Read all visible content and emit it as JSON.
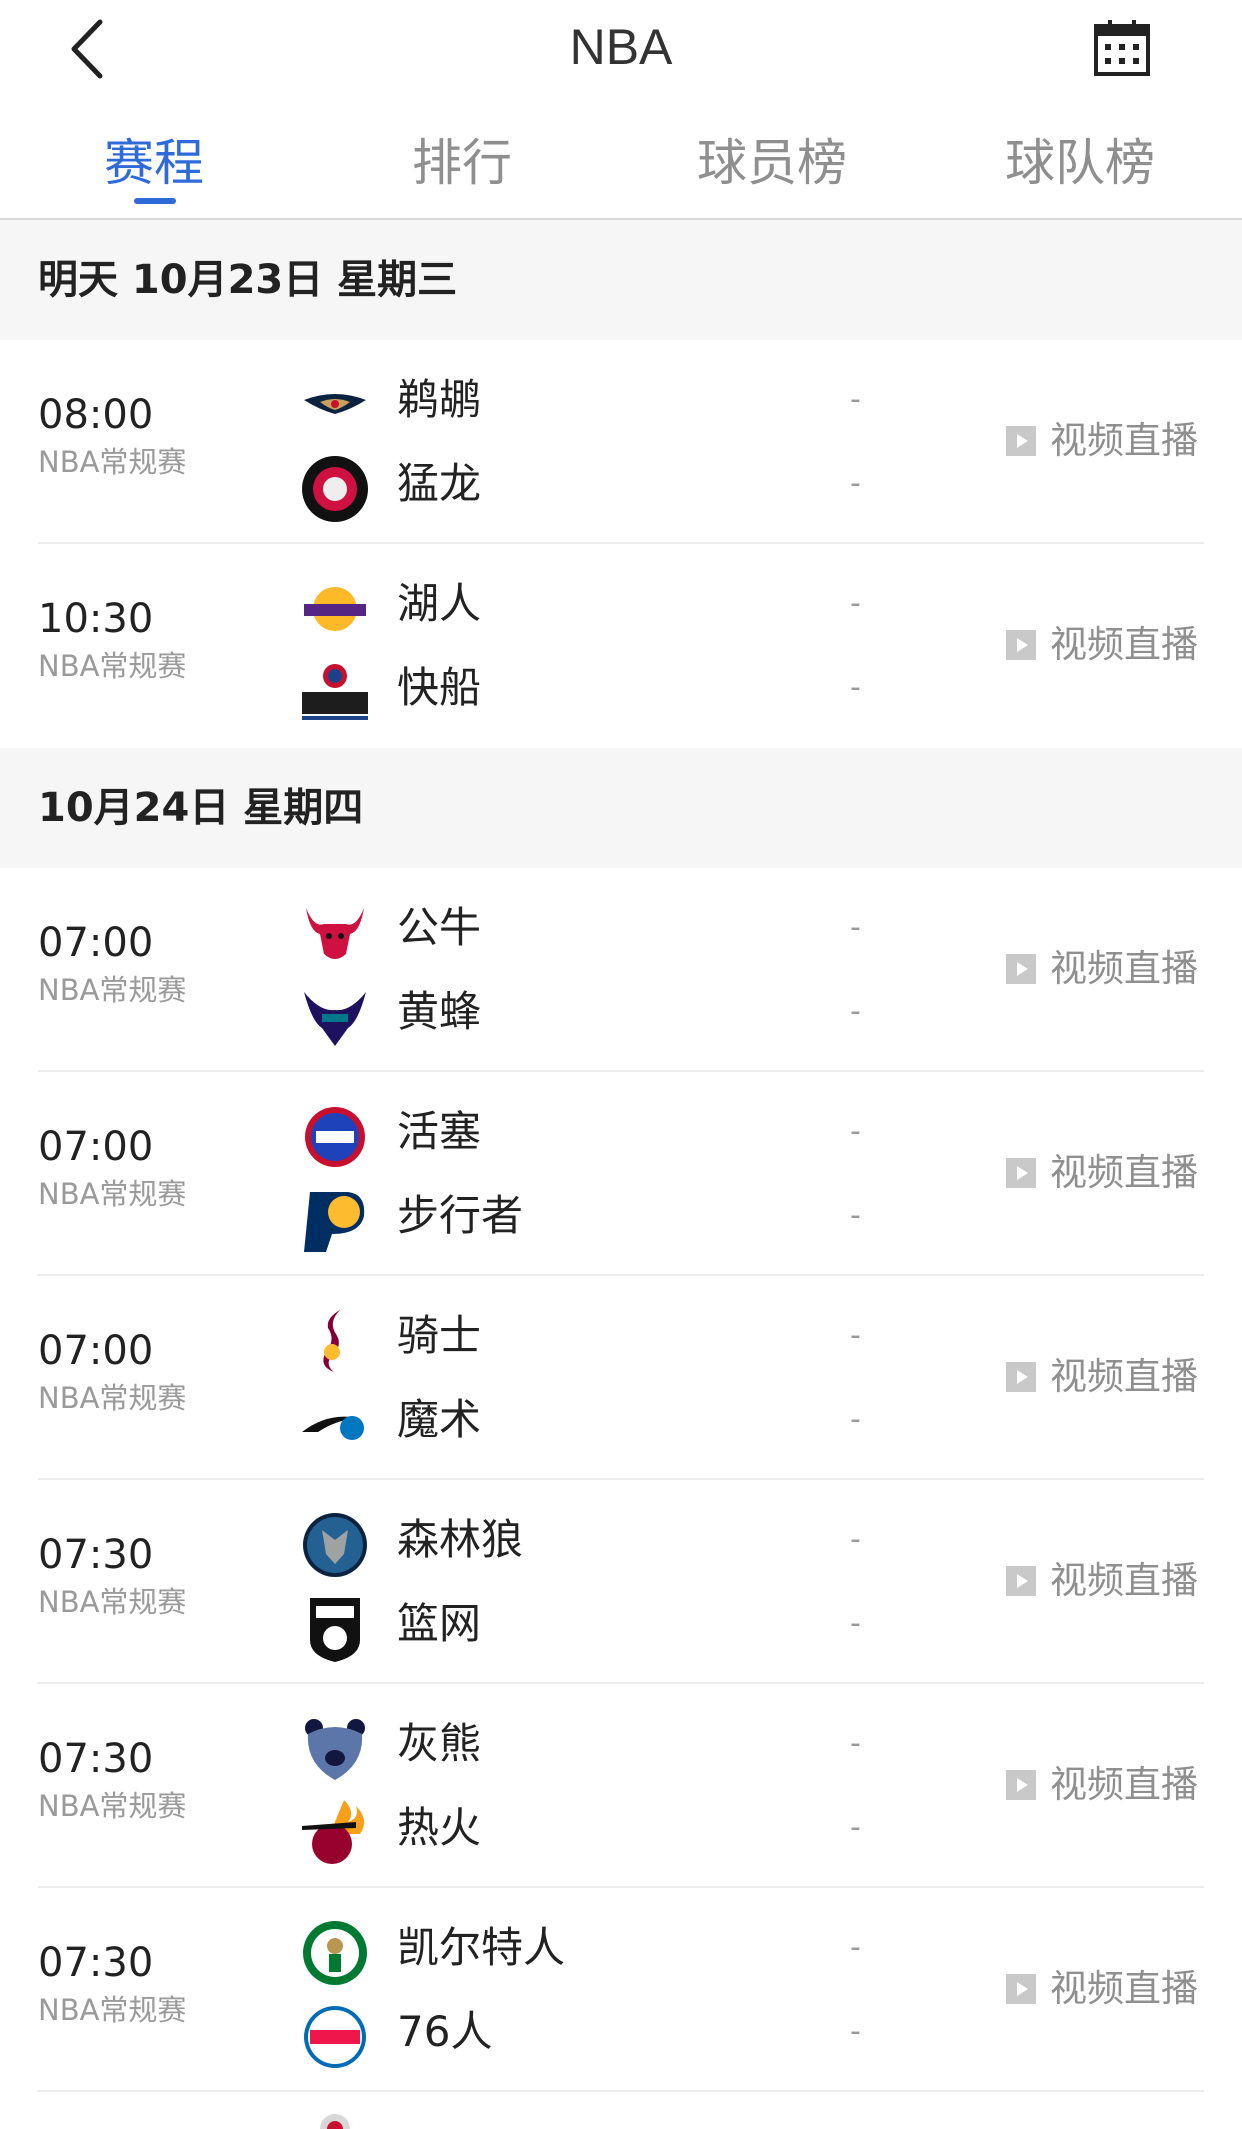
{
  "header": {
    "title": "NBA"
  },
  "tabs": [
    "赛程",
    "排行",
    "球员榜",
    "球队榜"
  ],
  "sections": [
    {
      "date": "明天 10月23日 星期三",
      "matches": [
        {
          "time": "08:00",
          "type": "NBA常规赛",
          "home": "鹈鹕",
          "away": "猛龙",
          "home_score": "-",
          "away_score": "-",
          "live": "视频直播"
        },
        {
          "time": "10:30",
          "type": "NBA常规赛",
          "home": "湖人",
          "away": "快船",
          "home_score": "-",
          "away_score": "-",
          "live": "视频直播"
        }
      ]
    },
    {
      "date": "10月24日 星期四",
      "matches": [
        {
          "time": "07:00",
          "type": "NBA常规赛",
          "home": "公牛",
          "away": "黄蜂",
          "home_score": "-",
          "away_score": "-",
          "live": "视频直播"
        },
        {
          "time": "07:00",
          "type": "NBA常规赛",
          "home": "活塞",
          "away": "步行者",
          "home_score": "-",
          "away_score": "-",
          "live": "视频直播"
        },
        {
          "time": "07:00",
          "type": "NBA常规赛",
          "home": "骑士",
          "away": "魔术",
          "home_score": "-",
          "away_score": "-",
          "live": "视频直播"
        },
        {
          "time": "07:30",
          "type": "NBA常规赛",
          "home": "森林狼",
          "away": "篮网",
          "home_score": "-",
          "away_score": "-",
          "live": "视频直播"
        },
        {
          "time": "07:30",
          "type": "NBA常规赛",
          "home": "灰熊",
          "away": "热火",
          "home_score": "-",
          "away_score": "-",
          "live": "视频直播"
        },
        {
          "time": "07:30",
          "type": "NBA常规赛",
          "home": "凯尔特人",
          "away": "76人",
          "home_score": "-",
          "away_score": "-",
          "live": "视频直播"
        }
      ]
    }
  ],
  "icons": {
    "back": "chevron-left-icon",
    "calendar": "calendar-icon",
    "live": "play-icon"
  },
  "colors": {
    "accent": "#2f6ad9",
    "muted": "#8f8f8f"
  }
}
